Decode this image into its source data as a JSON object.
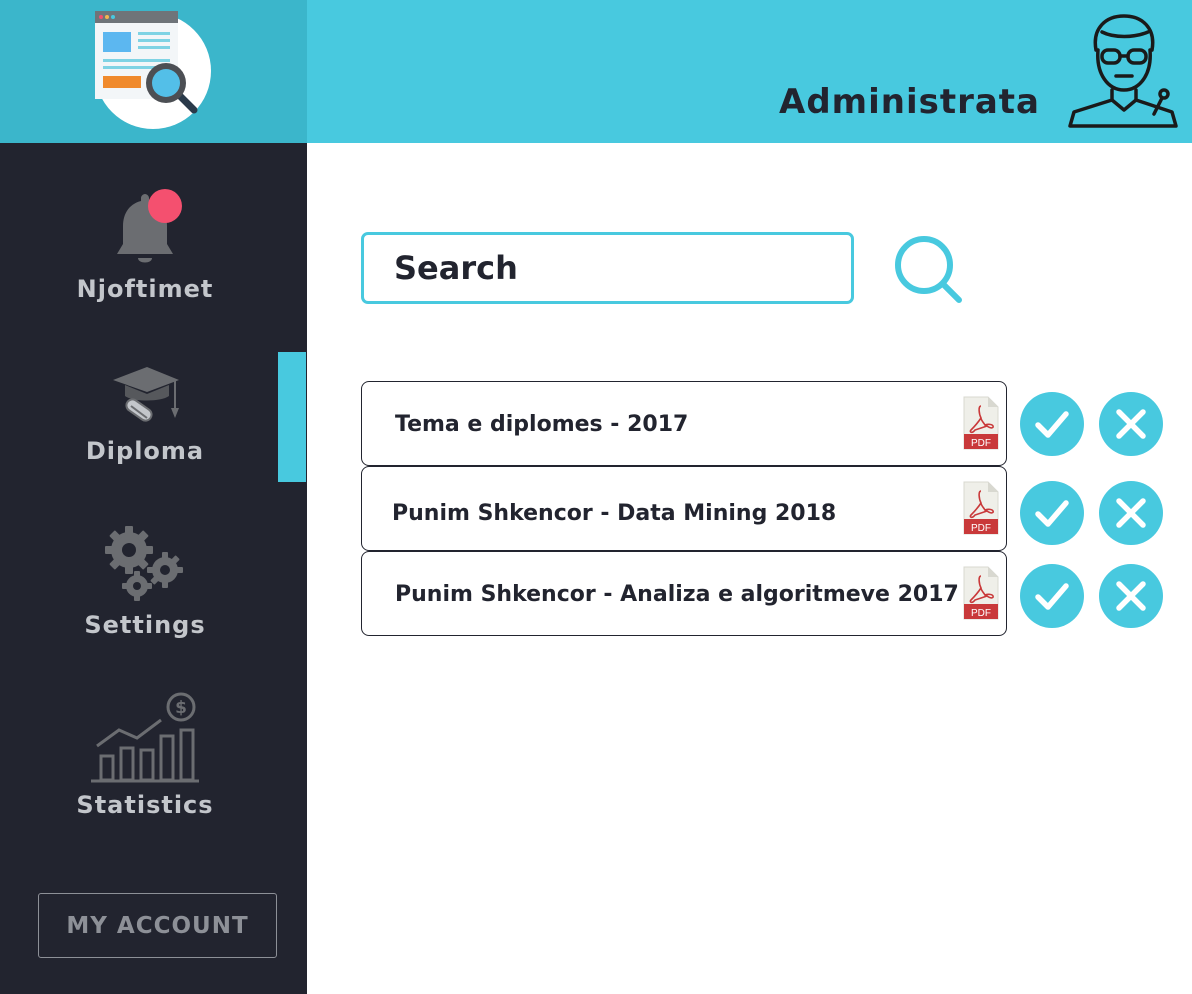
{
  "header": {
    "title": "Administrata"
  },
  "sidebar": {
    "items": [
      {
        "label": "Njoftimet",
        "icon": "bell-icon",
        "has_notification": true
      },
      {
        "label": "Diploma",
        "icon": "graduation-cap-icon",
        "active": true
      },
      {
        "label": "Settings",
        "icon": "gears-icon"
      },
      {
        "label": "Statistics",
        "icon": "statistics-chart-icon"
      }
    ],
    "account_label": "MY ACCOUNT"
  },
  "search": {
    "placeholder": "Search"
  },
  "documents": [
    {
      "title": "Tema e diplomes - 2017",
      "file_label": "PDF"
    },
    {
      "title": "Punim Shkencor - Data Mining 2018",
      "file_label": "PDF"
    },
    {
      "title": "Punim Shkencor - Analiza e algoritmeve 2017",
      "file_label": "PDF"
    }
  ],
  "colors": {
    "accent": "#48c9df",
    "sidebar": "#22242f",
    "logo_bg": "#3bb6cb",
    "notification": "#f4506f",
    "pdf_red": "#c9393a"
  }
}
